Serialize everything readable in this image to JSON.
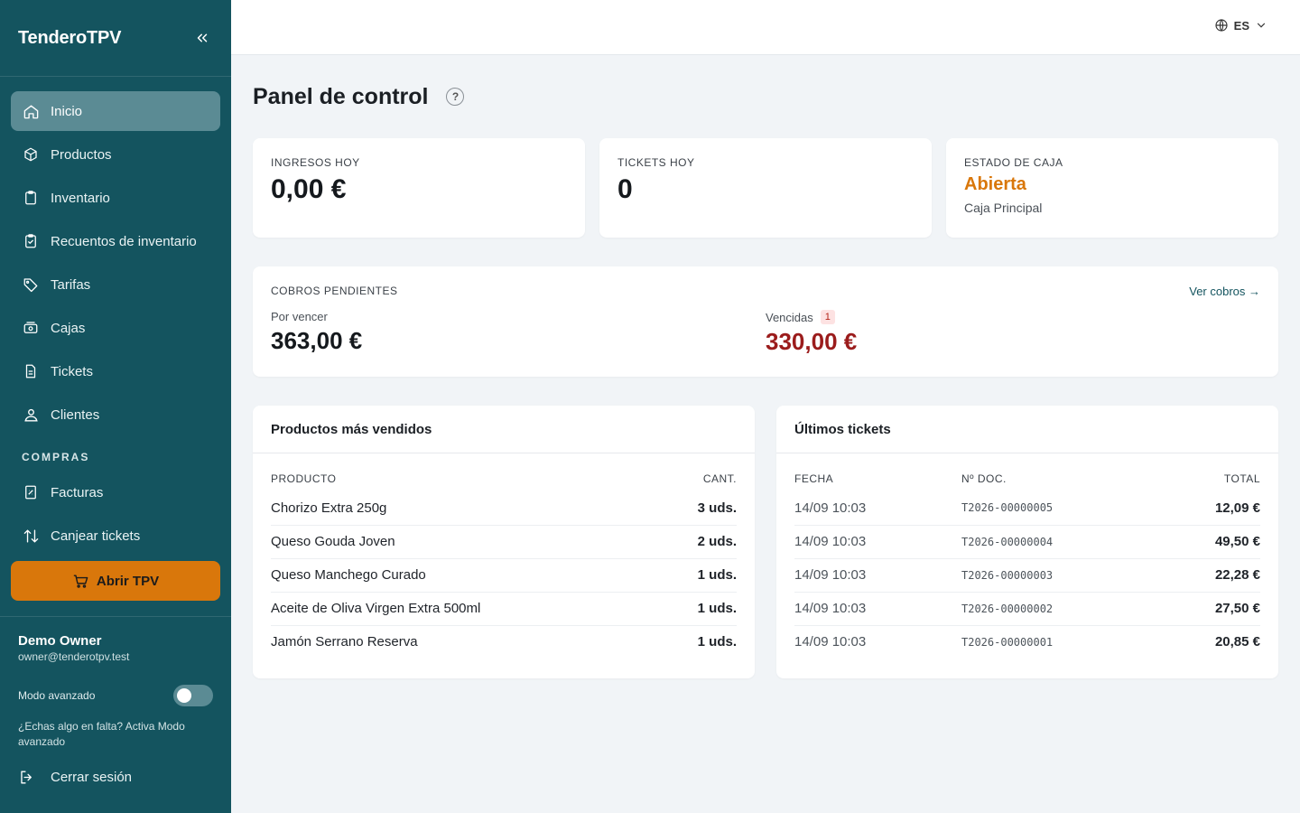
{
  "app": {
    "brand": "TenderoTPV"
  },
  "sidebar": {
    "items": [
      {
        "label": "Inicio",
        "icon": "home-icon",
        "active": true
      },
      {
        "label": "Productos",
        "icon": "box-icon"
      },
      {
        "label": "Inventario",
        "icon": "clipboard-icon"
      },
      {
        "label": "Recuentos de inventario",
        "icon": "clipboard-check-icon"
      },
      {
        "label": "Tarifas",
        "icon": "tag-icon"
      },
      {
        "label": "Cajas",
        "icon": "cash-register-icon"
      },
      {
        "label": "Tickets",
        "icon": "document-icon"
      },
      {
        "label": "Clientes",
        "icon": "users-icon"
      }
    ],
    "section_compras": "COMPRAS",
    "compras_items": [
      {
        "label": "Facturas",
        "icon": "invoice-icon"
      },
      {
        "label": "Canjear tickets",
        "icon": "exchange-icon"
      }
    ],
    "tpv_button": "Abrir TPV",
    "user": {
      "name": "Demo Owner",
      "email": "owner@tenderotpv.test"
    },
    "advanced_mode_label": "Modo avanzado",
    "advanced_mode_on": false,
    "advanced_hint": "¿Echas algo en falta? Activa Modo avanzado",
    "logout": "Cerrar sesión"
  },
  "topbar": {
    "language": "ES"
  },
  "page": {
    "title": "Panel de control",
    "help": "?"
  },
  "kpis": {
    "ingresos": {
      "label": "INGRESOS HOY",
      "value": "0,00 €"
    },
    "tickets": {
      "label": "TICKETS HOY",
      "value": "0"
    },
    "caja": {
      "label": "ESTADO DE CAJA",
      "status": "Abierta",
      "name": "Caja Principal"
    }
  },
  "cobros": {
    "label": "COBROS PENDIENTES",
    "link": "Ver cobros →",
    "por_vencer_label": "Por vencer",
    "por_vencer_value": "363,00 €",
    "vencidas_label": "Vencidas",
    "vencidas_count": "1",
    "vencidas_value": "330,00 €"
  },
  "top_products": {
    "title": "Productos más vendidos",
    "headers": [
      "PRODUCTO",
      "CANT."
    ],
    "rows": [
      [
        "Chorizo Extra 250g",
        "3 uds."
      ],
      [
        "Queso Gouda Joven",
        "2 uds."
      ],
      [
        "Queso Manchego Curado",
        "1 uds."
      ],
      [
        "Aceite de Oliva Virgen Extra 500ml",
        "1 uds."
      ],
      [
        "Jamón Serrano Reserva",
        "1 uds."
      ]
    ]
  },
  "last_tickets": {
    "title": "Últimos tickets",
    "headers": [
      "FECHA",
      "Nº DOC.",
      "TOTAL"
    ],
    "rows": [
      [
        "14/09 10:03",
        "T2026-00000005",
        "12,09 €"
      ],
      [
        "14/09 10:03",
        "T2026-00000004",
        "49,50 €"
      ],
      [
        "14/09 10:03",
        "T2026-00000003",
        "22,28 €"
      ],
      [
        "14/09 10:03",
        "T2026-00000002",
        "27,50 €"
      ],
      [
        "14/09 10:03",
        "T2026-00000001",
        "20,85 €"
      ]
    ]
  },
  "colors": {
    "sidebar": "#14545f",
    "accent": "#d9770b",
    "danger": "#9b1c1c"
  }
}
